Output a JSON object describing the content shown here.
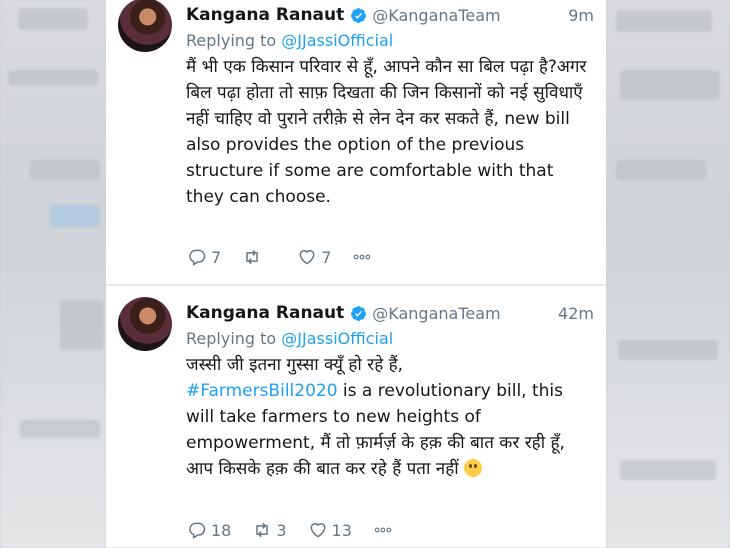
{
  "colors": {
    "link": "#1da1f2",
    "secondary": "#657786",
    "text": "#14171a",
    "verified": "#1da1f2"
  },
  "tweets": [
    {
      "name": "Kangana Ranaut",
      "handle": "@KanganaTeam",
      "time": "9m",
      "replying_prefix": "Replying to",
      "replying_to": "@JJassiOfficial",
      "text": "मैं भी एक किसान परिवार से हूँ, आपने कौन सा बिल पढ़ा है?अगर बिल पढ़ा होता तो साफ़ दिखता की जिन किसानों को नई सुविधाएँ नहीं चाहिए वो पुराने तरीक़े से लेन देन कर सकते हैं, new bill also provides the option of the previous structure if some are comfortable with that they can choose.",
      "reply_count": "7",
      "retweet_count": "",
      "like_count": "7",
      "more_icon": "ellipsis-icon"
    },
    {
      "name": "Kangana Ranaut",
      "handle": "@KanganaTeam",
      "time": "42m",
      "replying_prefix": "Replying to",
      "replying_to": "@JJassiOfficial",
      "text_line1": "जस्सी जी इतना गुस्सा क्यूँ हो रहे हैं,",
      "hashtag": "#FarmersBill2020",
      "text_rest": " is a revolutionary bill, this will take farmers to new heights of empowerment, मैं तो फ़ार्मर्ज़ के हक़ की बात कर रही हूँ, आप किसके हक़ की बात कर रहे हैं पता नहीं ",
      "emoji": "slightly-smiling-face",
      "reply_count": "18",
      "retweet_count": "3",
      "like_count": "13",
      "more_icon": "ellipsis-icon"
    }
  ]
}
